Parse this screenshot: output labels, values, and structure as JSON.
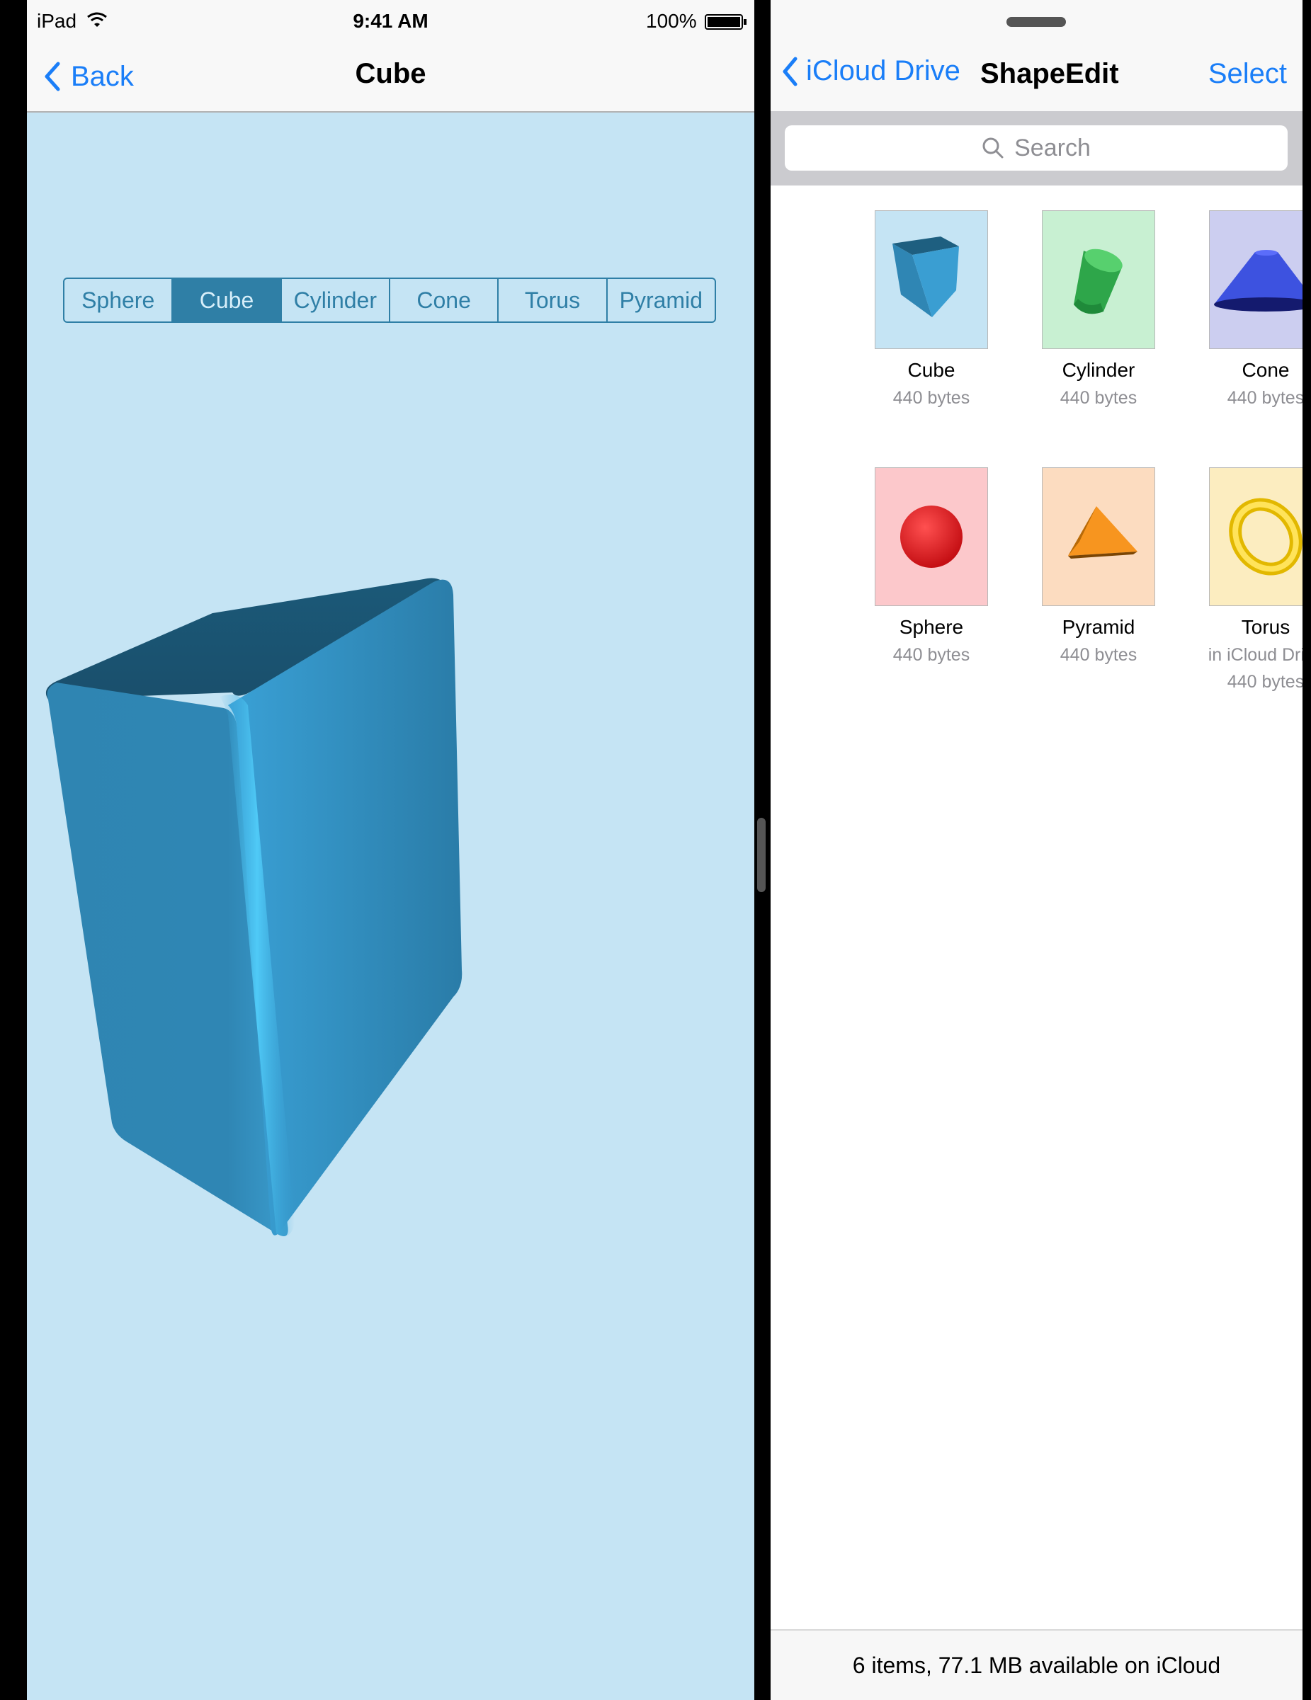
{
  "status_bar": {
    "carrier": "iPad",
    "time": "9:41 AM",
    "battery": "100%"
  },
  "left_pane": {
    "back_label": "Back",
    "title": "Cube",
    "segments": [
      "Sphere",
      "Cube",
      "Cylinder",
      "Cone",
      "Torus",
      "Pyramid"
    ],
    "selected_segment": "Cube",
    "background_color": "#c5e4f4",
    "shape_color": "#3a9cd0"
  },
  "right_pane": {
    "back_label": "iCloud Drive",
    "title": "ShapeEdit",
    "select_label": "Select",
    "search_placeholder": "Search",
    "files": [
      {
        "name": "Cube",
        "subtitle": "",
        "size": "440 bytes",
        "thumb_color": "#c5e4f4",
        "icon": "cube-icon"
      },
      {
        "name": "Cylinder",
        "subtitle": "",
        "size": "440 bytes",
        "thumb_color": "#c8f0d2",
        "icon": "cylinder-icon"
      },
      {
        "name": "Cone",
        "subtitle": "",
        "size": "440 bytes",
        "thumb_color": "#cccef0",
        "icon": "cone-icon"
      },
      {
        "name": "Sphere",
        "subtitle": "",
        "size": "440 bytes",
        "thumb_color": "#fcc8cb",
        "icon": "sphere-icon"
      },
      {
        "name": "Pyramid",
        "subtitle": "",
        "size": "440 bytes",
        "thumb_color": "#fcdcc0",
        "icon": "pyramid-icon"
      },
      {
        "name": "Torus",
        "subtitle": "in iCloud Drive",
        "size": "440 bytes",
        "thumb_color": "#fcedc0",
        "icon": "torus-icon"
      }
    ],
    "footer": "6 items, 77.1 MB available on iCloud",
    "accent_color": "#1a7ef8"
  }
}
